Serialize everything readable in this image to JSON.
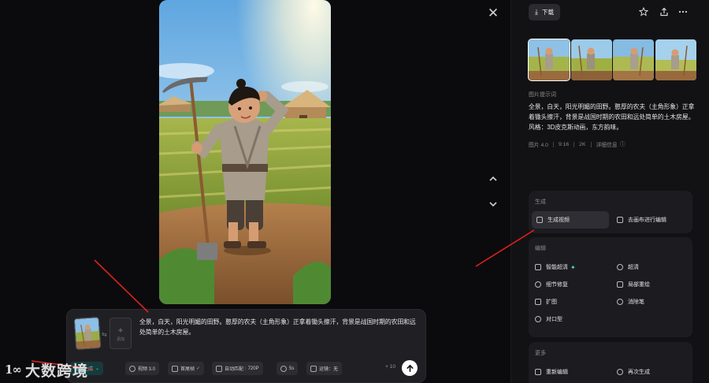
{
  "viewer": {
    "close_icon": "close-icon",
    "nav_up_icon": "chevron-up-icon",
    "nav_down_icon": "chevron-down-icon"
  },
  "composer": {
    "ref_swap_symbol": "⇆",
    "ref_add_label": "添加",
    "prompt": "全景，白天，阳光明媚的田野。憨厚的农夫（主角形象）正拿着锄头擦汗，背景是战国时期的农田和远处简单的土木房屋。",
    "toolbar": {
      "mode_label": "视频生成",
      "model_label": "视频 3.0",
      "frame_label": "首尾帧",
      "ratio_label": "自动匹配",
      "resolution": "720P",
      "duration": "5s",
      "camera_label": "运镜：无"
    },
    "count": "+ 10",
    "send_icon": "arrow-up-icon"
  },
  "sidebar": {
    "download_label": "下载",
    "icons": [
      "star-icon",
      "share-icon",
      "more-icon"
    ],
    "prompt_label": "图片提示词",
    "prompt": "全景，白天，阳光明媚的田野。憨厚的农夫（主角形象）正拿着锄头擦汗，背景是战国时期的农田和远处简单的土木房屋。风格：3D皮克斯动画，东方韵味。",
    "meta": {
      "model": "图片 4.0",
      "ratio": "9:16",
      "resolution": "2K",
      "details_label": "详细信息"
    },
    "generate": {
      "title": "生成",
      "items": [
        {
          "label": "生成视频",
          "icon": "video-icon"
        },
        {
          "label": "去画布进行编辑",
          "icon": "canvas-icon"
        }
      ]
    },
    "edit": {
      "title": "编辑",
      "items": [
        {
          "label": "智能超清",
          "icon": "hd-icon"
        },
        {
          "label": "超清",
          "icon": "upscale-icon"
        },
        {
          "label": "细节修复",
          "icon": "repair-icon"
        },
        {
          "label": "局部重绘",
          "icon": "inpaint-icon"
        },
        {
          "label": "扩图",
          "icon": "expand-icon"
        },
        {
          "label": "消除笔",
          "icon": "eraser-icon"
        },
        {
          "label": "对口型",
          "icon": "lipsync-icon"
        }
      ]
    },
    "more": {
      "title": "更多",
      "items": [
        {
          "label": "重新编辑",
          "icon": "reedit-icon"
        },
        {
          "label": "再次生成",
          "icon": "regenerate-icon"
        }
      ]
    }
  },
  "watermark": {
    "logo": "1∞",
    "text": "大数跨境"
  },
  "colors": {
    "background": "#0d0d0f",
    "panel": "#1c1c20",
    "accent": "#4fd3cf",
    "annotation": "#e02020"
  }
}
